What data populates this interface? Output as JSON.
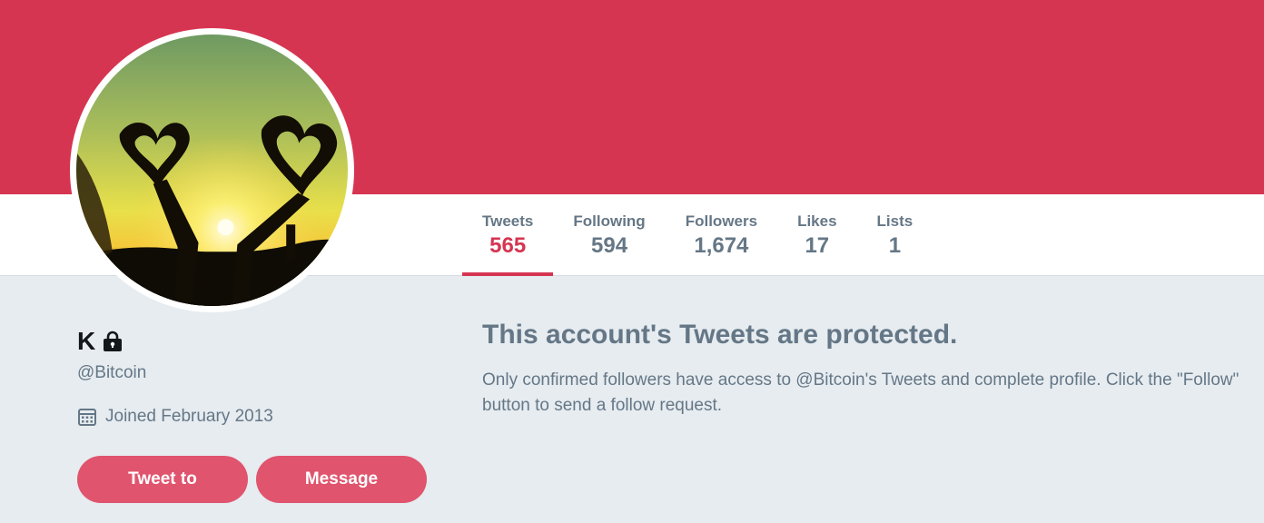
{
  "colors": {
    "accent": "#d63552",
    "button": "#e0546e",
    "muted_text": "#657786",
    "background": "#e6ecf0"
  },
  "profile": {
    "name": "K",
    "handle": "@Bitcoin",
    "joined": "Joined February 2013",
    "protected_icon": "lock-icon",
    "joined_icon": "calendar-icon"
  },
  "stats": [
    {
      "label": "Tweets",
      "value": "565",
      "active": true
    },
    {
      "label": "Following",
      "value": "594"
    },
    {
      "label": "Followers",
      "value": "1,674"
    },
    {
      "label": "Likes",
      "value": "17"
    },
    {
      "label": "Lists",
      "value": "1"
    }
  ],
  "buttons": {
    "tweet_to": "Tweet to",
    "message": "Message"
  },
  "protected": {
    "title": "This account's Tweets are protected.",
    "text": "Only confirmed followers have access to @Bitcoin's Tweets and complete profile. Click the \"Follow\" button to send a follow request."
  }
}
